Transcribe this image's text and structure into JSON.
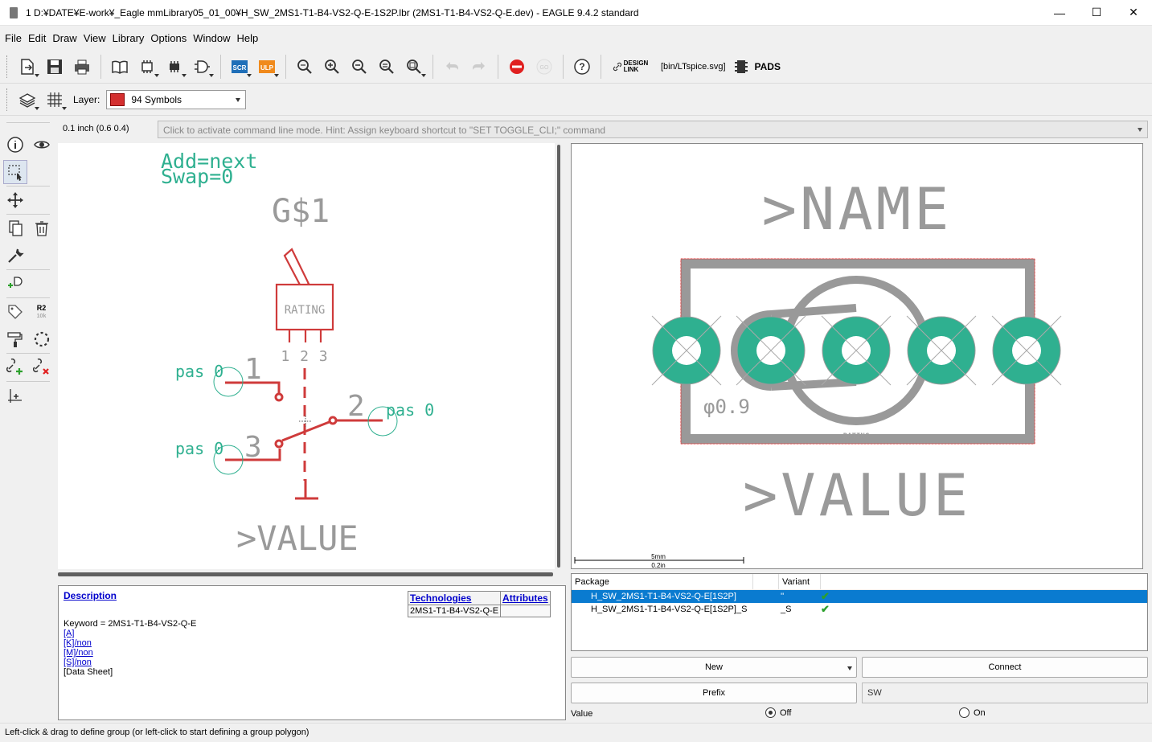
{
  "window": {
    "title": "1 D:¥DATE¥E-work¥_Eagle mmLibrary05_01_00¥H_SW_2MS1-T1-B4-VS2-Q-E-1S2P.lbr (2MS1-T1-B4-VS2-Q-E.dev) - EAGLE 9.4.2 standard",
    "minimize": "—",
    "maximize": "☐",
    "close": "✕"
  },
  "menu": [
    "File",
    "Edit",
    "Draw",
    "View",
    "Library",
    "Options",
    "Window",
    "Help"
  ],
  "toolbar": {
    "scr_label": "SCR",
    "ulp_label": "ULP",
    "go_label": "GO",
    "help_label": "?",
    "design_link_line1": "DESIGN",
    "design_link_line2": "LINK",
    "ulp_path": "[bin/LTspice.svg]",
    "pads_label": "PADS"
  },
  "layer": {
    "label": "Layer:",
    "value": "94 Symbols",
    "color": "#d32f2f"
  },
  "lefttools": {
    "r2_label": "R2",
    "r2_sub": "10k"
  },
  "coords": "0.1 inch (0.6 0.4)",
  "command_line": "Click to activate command line mode. Hint: Assign keyboard shortcut to \"SET TOGGLE_CLI;\" command",
  "symbol": {
    "add_text": "Add=next",
    "swap_text": "Swap=0",
    "name_text": "G$1",
    "rating_text": "RATING",
    "pin_numbers": "1 2 3",
    "pin1_label": "pas 0",
    "pin1_num": "1",
    "pin2_label": "pas 0",
    "pin2_num": "2",
    "pin3_label": "pas 0",
    "pin3_num": "3",
    "value_text": ">VALUE"
  },
  "package": {
    "name_text": ">NAME",
    "value_text": ">VALUE",
    "hole_text": "φ0.9",
    "rating_text": "RATING",
    "scale_top": "5mm",
    "scale_bottom": "0.2in"
  },
  "description": {
    "title": "Description",
    "keyword": "Keyword = 2MS1-T1-B4-VS2-Q-E",
    "links": [
      "[A]",
      "[K]/non",
      "[M]/non",
      "[S]/non"
    ],
    "datasheet": "[Data Sheet]",
    "tech_header": "Technologies",
    "attr_header": "Attributes",
    "tech_value": "2MS1-T1-B4-VS2-Q-E"
  },
  "variants": {
    "col_package": "Package",
    "col_variant": "Variant",
    "rows": [
      {
        "package": "H_SW_2MS1-T1-B4-VS2-Q-E[1S2P]",
        "variant": "''",
        "check": "✔"
      },
      {
        "package": "H_SW_2MS1-T1-B4-VS2-Q-E[1S2P]_S",
        "variant": "_S",
        "check": "✔"
      }
    ]
  },
  "buttons": {
    "new": "New",
    "connect": "Connect",
    "prefix": "Prefix",
    "prefix_value": "SW"
  },
  "value_setting": {
    "label": "Value",
    "off": "Off",
    "on": "On"
  },
  "status": "Left-click & drag to define group (or left-click to start defining a group polygon)"
}
